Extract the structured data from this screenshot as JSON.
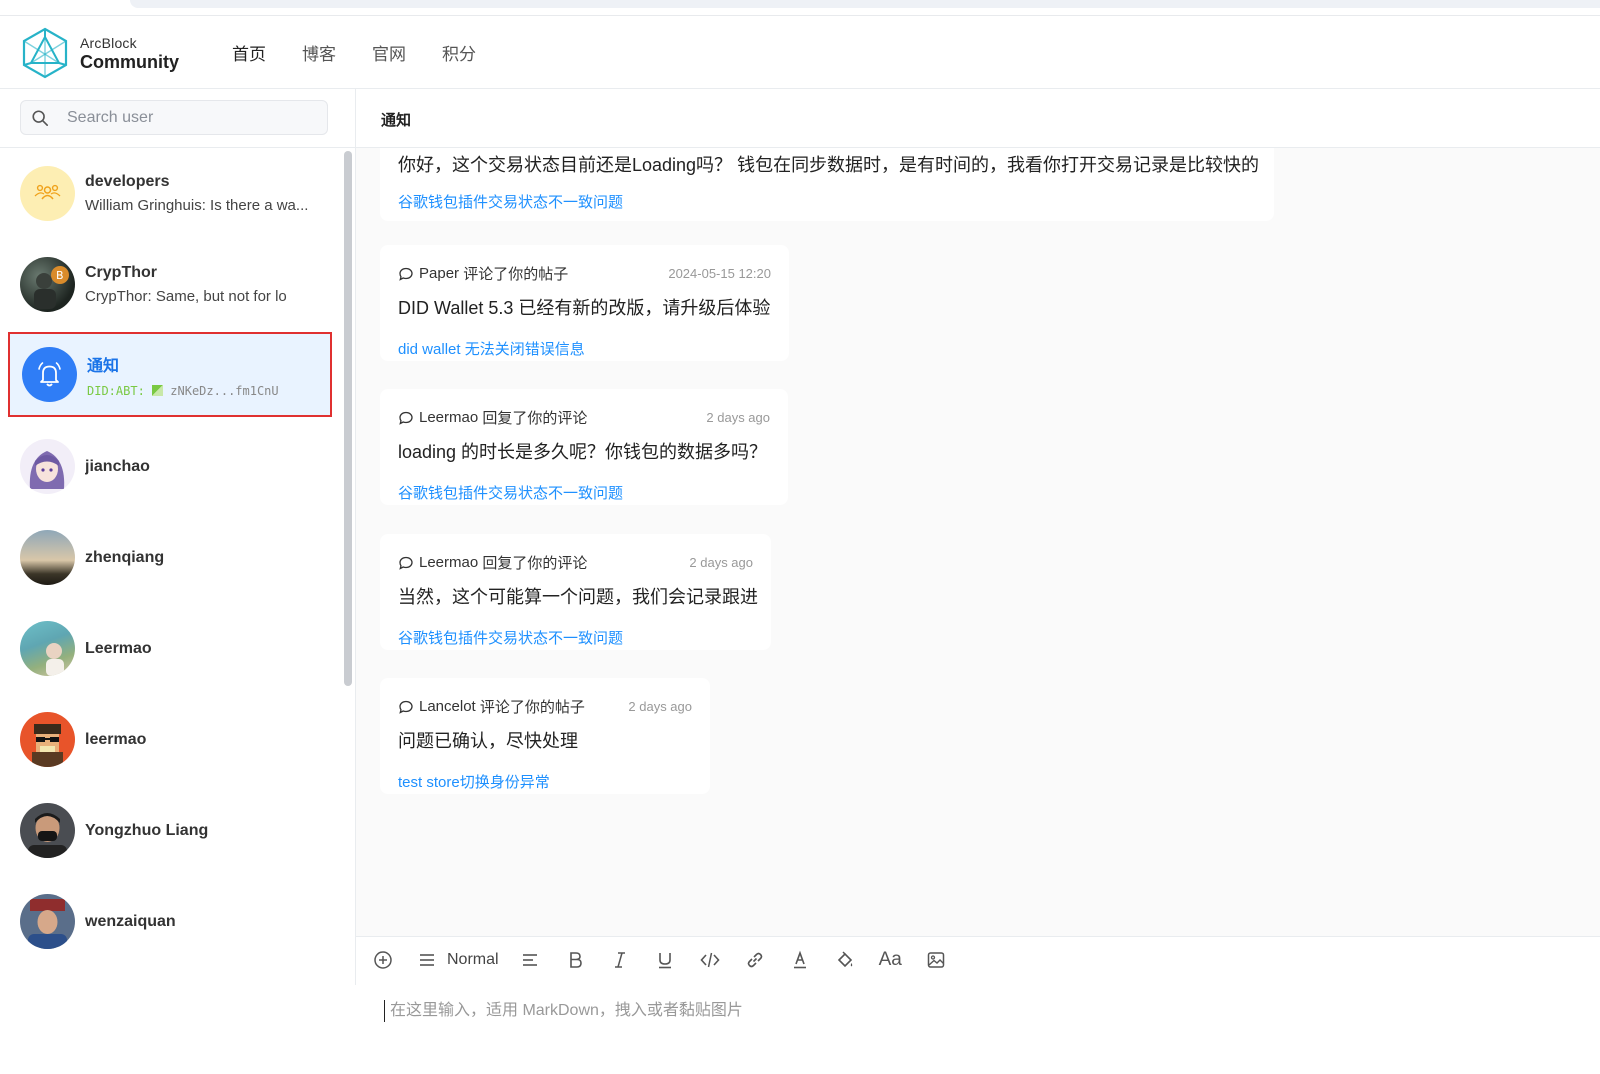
{
  "brand": {
    "line1": "ArcBlock",
    "line2": "Community",
    "accent": "#27b3c8"
  },
  "nav": [
    {
      "label": "首页"
    },
    {
      "label": "博客"
    },
    {
      "label": "官网"
    },
    {
      "label": "积分"
    }
  ],
  "search": {
    "placeholder": "Search user",
    "icon": "search-icon"
  },
  "users": [
    {
      "name": "developers",
      "preview": "William Gringhuis: Is there a wa..."
    },
    {
      "name": "CrypThor",
      "preview": "CrypThor: Same, but not for lo"
    },
    {
      "name": "通知",
      "did_prefix": "DID:ABT:",
      "did_value": "zNKeDz...fm1CnU",
      "selected": true
    },
    {
      "name": "jianchao"
    },
    {
      "name": "zhenqiang"
    },
    {
      "name": "Leermao"
    },
    {
      "name": "leermao"
    },
    {
      "name": "Yongzhuo Liang"
    },
    {
      "name": "wenzaiquan"
    }
  ],
  "main": {
    "title": "通知",
    "notifications": [
      {
        "body": "你好，这个交易状态目前还是Loading吗？ 钱包在同步数据时，是有时间的，我看你打开交易记录是比较快的",
        "link": "谷歌钱包插件交易状态不一致问题"
      },
      {
        "actor": "Paper",
        "action": "评论了你的帖子",
        "time": "2024-05-15 12:20",
        "body": "DID Wallet 5.3 已经有新的改版，请升级后体验",
        "link": "did wallet 无法关闭错误信息"
      },
      {
        "actor": "Leermao",
        "action": "回复了你的评论",
        "time": "2 days ago",
        "body": "loading 的时长是多久呢？你钱包的数据多吗？",
        "link": "谷歌钱包插件交易状态不一致问题"
      },
      {
        "actor": "Leermao",
        "action": "回复了你的评论",
        "time": "2 days ago",
        "body": "当然，这个可能算一个问题，我们会记录跟进",
        "link": "谷歌钱包插件交易状态不一致问题"
      },
      {
        "actor": "Lancelot",
        "action": "评论了你的帖子",
        "time": "2 days ago",
        "body": "问题已确认，尽快处理",
        "link": "test store切换身份异常"
      }
    ]
  },
  "editor": {
    "format_label": "Normal",
    "placeholder": "在这里输入，适用 MarkDown，拽入或者黏贴图片",
    "font_glyph": "Aa"
  },
  "colors": {
    "link": "#1e90ff",
    "selected_bg": "#e9f3ff",
    "highlight_border": "#e03030",
    "notify_avatar": "#2f7df6"
  }
}
